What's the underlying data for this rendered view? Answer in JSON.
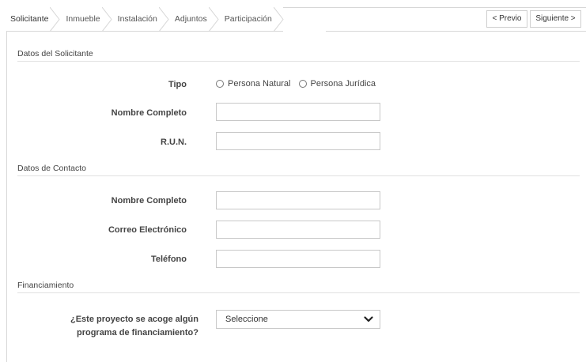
{
  "wizard": {
    "steps": [
      {
        "label": "Solicitante"
      },
      {
        "label": "Inmueble"
      },
      {
        "label": "Instalación"
      },
      {
        "label": "Adjuntos"
      },
      {
        "label": "Participación"
      }
    ],
    "prev_label": "< Previo",
    "next_label": "Siguiente >"
  },
  "solicitante": {
    "title": "Datos del Solicitante",
    "tipo_label": "Tipo",
    "tipo_options": [
      "Persona Natural",
      "Persona Jurídica"
    ],
    "nombre_label": "Nombre Completo",
    "nombre_value": "",
    "run_label": "R.U.N.",
    "run_value": ""
  },
  "contacto": {
    "title": "Datos de Contacto",
    "nombre_label": "Nombre Completo",
    "nombre_value": "",
    "correo_label": "Correo Electrónico",
    "correo_value": "",
    "telefono_label": "Teléfono",
    "telefono_value": ""
  },
  "financiamiento": {
    "title": "Financiamiento",
    "question_line1": "¿Este proyecto se acoge algún",
    "question_line2": "programa de financiamiento?",
    "select_value": "Seleccione"
  }
}
